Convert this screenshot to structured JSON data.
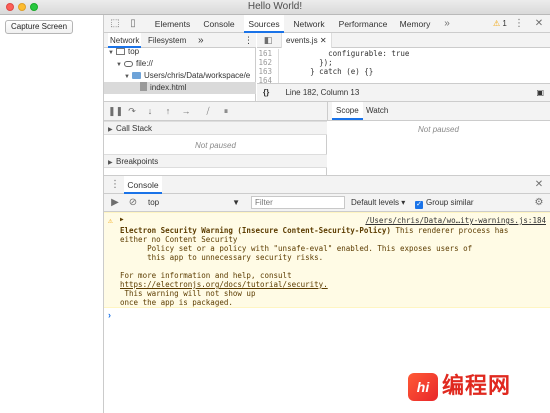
{
  "window": {
    "title": "Hello World!"
  },
  "app": {
    "capture_button": "Capture Screen"
  },
  "devtools": {
    "main_tabs": [
      "Elements",
      "Console",
      "Sources",
      "Network",
      "Performance",
      "Memory"
    ],
    "active_tab": "Sources",
    "more_tabs_glyph": "»",
    "warning_count": "1",
    "navigator": {
      "tabs": [
        "Network",
        "Filesystem"
      ],
      "more_glyph": "»",
      "tree": [
        {
          "label": "top",
          "type": "frame",
          "depth": 0
        },
        {
          "label": "file://",
          "type": "cloud",
          "depth": 1
        },
        {
          "label": "Users/chris/Data/workspace/e",
          "type": "folder",
          "depth": 2
        },
        {
          "label": "index.html",
          "type": "file",
          "depth": 3,
          "selected": true
        }
      ]
    },
    "editor": {
      "tab_label": "events.js",
      "lines": [
        {
          "num": "161",
          "text": "          configurable: true"
        },
        {
          "num": "162",
          "text": "        });"
        },
        {
          "num": "163",
          "text": "      } catch (e) {}"
        },
        {
          "num": "164",
          "text": ""
        }
      ],
      "status": "Line 182, Column 13",
      "format_glyph": "{}"
    },
    "debugger": {
      "call_stack_label": "Call Stack",
      "breakpoints_label": "Breakpoints",
      "not_paused": "Not paused",
      "scope_tabs": [
        "Scope",
        "Watch"
      ],
      "scope_not_paused": "Not paused"
    },
    "console": {
      "drawer_tab": "Console",
      "context": "top",
      "filter_placeholder": "Filter",
      "levels": "Default levels ▾",
      "group_similar": "Group similar",
      "warning": {
        "source_link": "/Users/chris/Data/wo…ity-warnings.js:184",
        "title": "Electron Security Warning (Insecure Content-Security-Policy)",
        "title_tail": " This renderer process has",
        "lines": [
          "either no Content Security",
          "      Policy set or a policy with \"unsafe-eval\" enabled. This exposes users of",
          "      this app to unnecessary security risks.",
          "",
          "For more information and help, consult"
        ],
        "help_url": "https://electronjs.org/docs/tutorial/security.",
        "lines_after": [
          " This warning will not show up",
          "once the app is packaged."
        ]
      },
      "prompt": "›"
    }
  },
  "watermark": {
    "logo_text": "hi",
    "text": "编程网"
  },
  "colors": {
    "accent": "#1a73e8",
    "warning_bg": "#fffbe5",
    "warning_icon": "#f2a50a"
  }
}
